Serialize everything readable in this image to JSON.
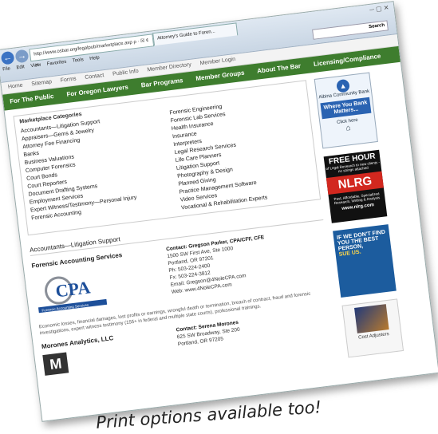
{
  "browser": {
    "address": "http://www.osbar.org/legalpub/marketplace.asp",
    "address_controls": "ρ · ☒ ¢ ✕",
    "tab_title": "Attorney's Guide to Foren...",
    "search_label": "Search",
    "menu": [
      "File",
      "Edit",
      "View",
      "Favorites",
      "Tools",
      "Help"
    ]
  },
  "top_nav": [
    "Home",
    "Sitemap",
    "Forms",
    "Contact",
    "Public Info",
    "Member Directory",
    "Member Login"
  ],
  "green_nav": [
    "For The Public",
    "For Oregon Lawyers",
    "Bar Programs",
    "Member Groups",
    "About The Bar",
    "Licensing/Compliance"
  ],
  "marketplace": {
    "title": "Marketplace Categories",
    "left": [
      "Accountants—Litigation Support",
      "Appraisers—Gems & Jewelry",
      "Attorney Fee Financing",
      "Banks",
      "Business Valuations",
      "Computer Forensics",
      "Court Bonds",
      "Court Reporters",
      "Document Drafting Systems",
      "Employment Services",
      "Expert Witness/Testimony—Personal Injury",
      "Forensic Accounting"
    ],
    "right": [
      "Forensic Engineering",
      "Forensic Lab Services",
      "Health Insurance",
      "Insurance",
      "Interpreters",
      "Legal Research Services",
      "Life Care Planners",
      "Litigation Support",
      "Photography & Design",
      "Planned Giving",
      "Practice Management Software",
      "Video Services",
      "Vocational & Rehabilitation Experts"
    ]
  },
  "section_title": "Accountants—Litigation Support",
  "listing1": {
    "name": "Forensic Accounting Services",
    "logo_text": "CPA",
    "logo_sub": "Forensic Accounting Services",
    "contact": "Contact: Gregson Parker, CPA/CFF, CFE",
    "address1": "1500 SW First Ave, Ste 1000",
    "address2": "Portland, OR 97201",
    "phone": "Ph: 503-224-2400",
    "fax": "Fx: 503-224-3812",
    "email": "Email: Gregson@4NoleCPA.com",
    "web": "Web: www.4NoleCPA.com",
    "description": "Economic losses, financial damages, lost profits or earnings, wrongful death or termination, breach of contract, fraud and forensic investigations, expert witness testimony (155+ in federal and multiple state courts), professional trainings."
  },
  "listing2": {
    "name": "Morones Analytics, LLC",
    "logo_text": "M",
    "contact": "Contact: Serena Morones",
    "address1": "625 SW Broadway, Ste 200",
    "address2": "Portland, OR 97205"
  },
  "ads": {
    "ad1_bank": "Albina Community Bank",
    "ad1_big": "Where You Bank Matters...",
    "ad1_link": "Click here",
    "ad2_top": "FREE HOUR",
    "ad2_mid": "of Legal Research to new clients - no strings attached",
    "ad2_logo": "NLRG",
    "ad2_tag": "Past, Affordable, Specialized Research, Writing & Analysis",
    "ad2_url": "www.nlrg.com",
    "ad3_line1": "IF WE DON'T FIND YOU THE BEST PERSON,",
    "ad3_line2": "SUE US.",
    "ad4_text": "Cost Adjusters"
  },
  "caption": "Print options available too!"
}
